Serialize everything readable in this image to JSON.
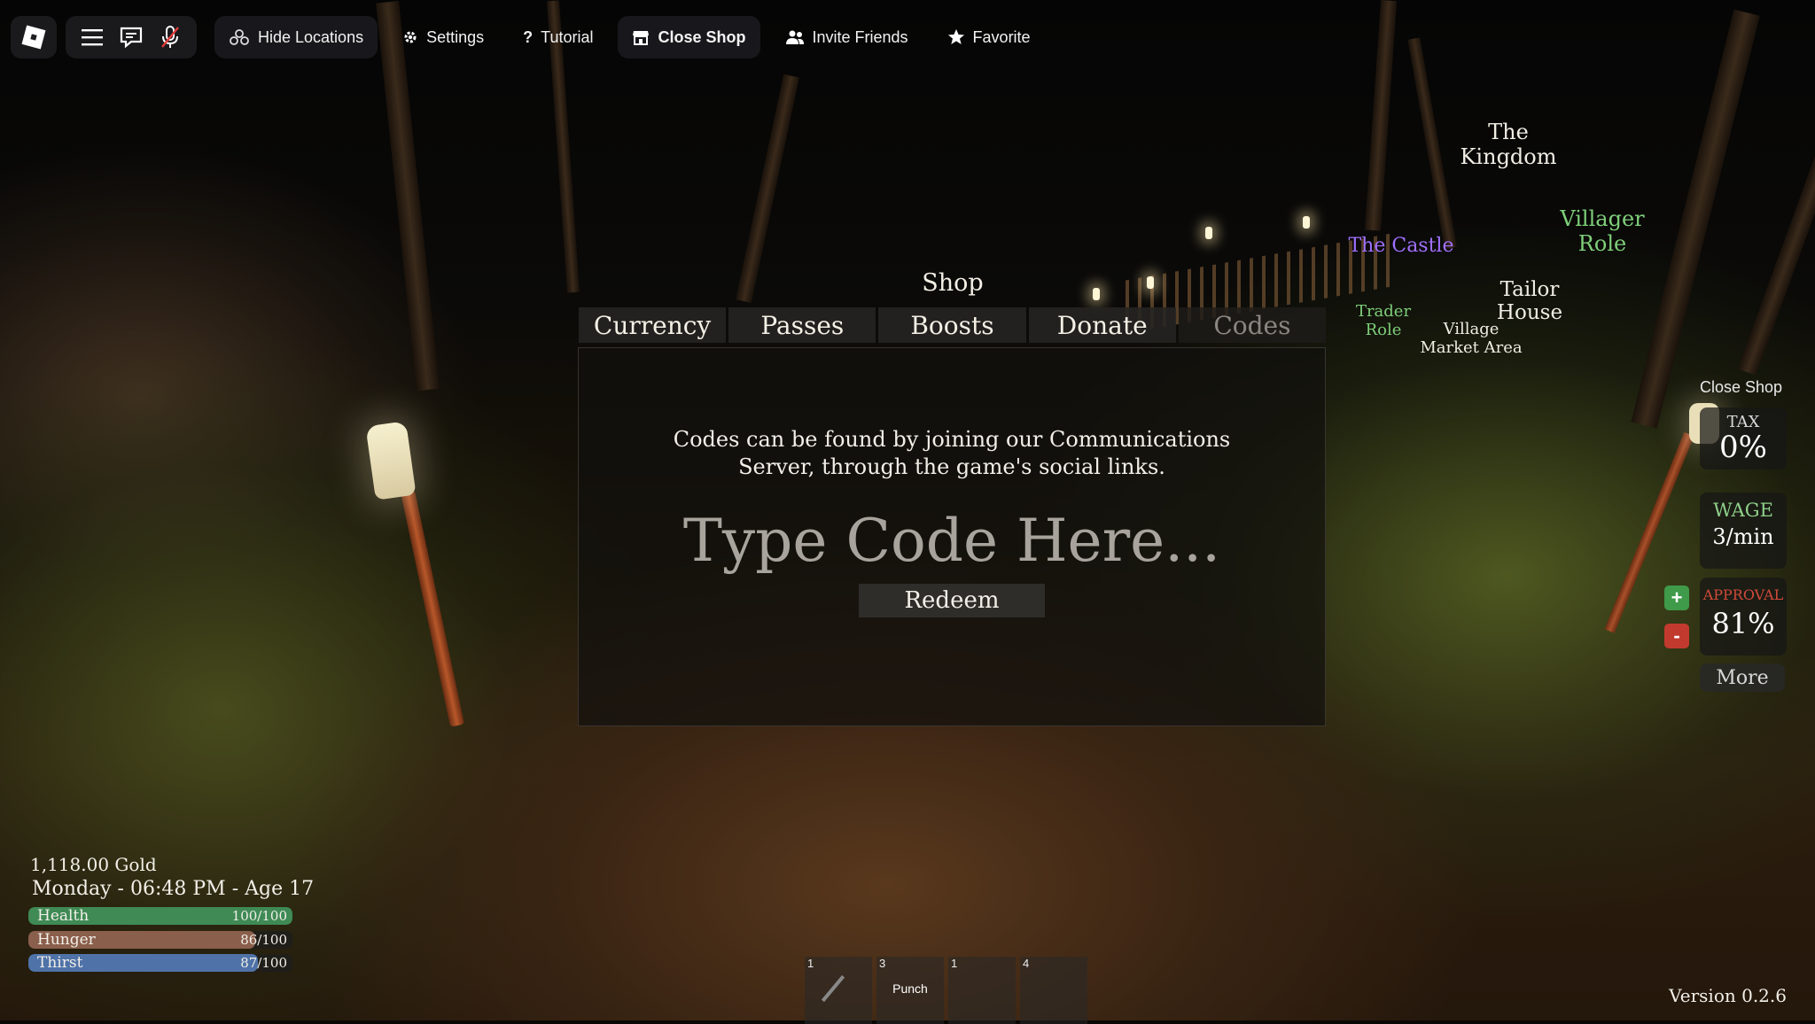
{
  "topbar": {
    "hide_locations": "Hide Locations",
    "settings": "Settings",
    "tutorial": "Tutorial",
    "close_shop": "Close Shop",
    "invite_friends": "Invite Friends",
    "favorite": "Favorite"
  },
  "shop": {
    "title": "Shop",
    "tabs": [
      "Currency",
      "Passes",
      "Boosts",
      "Donate",
      "Codes"
    ],
    "active_tab": "Codes",
    "info_line1": "Codes can be found by joining our Communications",
    "info_line2": "Server, through the game's social links.",
    "code_placeholder": "Type Code Here...",
    "redeem": "Redeem"
  },
  "map_labels": {
    "kingdom_1": "The",
    "kingdom_2": "Kingdom",
    "castle": "The Castle",
    "villager_1": "Villager",
    "villager_2": "Role",
    "tailor_1": "Tailor",
    "tailor_2": "House",
    "trader_1": "Trader",
    "trader_2": "Role",
    "market_1": "Village",
    "market_2": "Market Area"
  },
  "hud": {
    "close_shop": "Close Shop",
    "tax_label": "TAX",
    "tax_value": "0%",
    "wage_label": "WAGE",
    "wage_value": "3/min",
    "approval_label": "APPROVAL",
    "approval_value": "81%",
    "plus": "+",
    "minus": "-",
    "more": "More"
  },
  "player": {
    "gold": "1,118.00 Gold",
    "datetime": "Monday - 06:48 PM - Age 17",
    "stats": [
      {
        "name": "Health",
        "value": "100/100",
        "fraction": 1.0,
        "color": "#3f8a55"
      },
      {
        "name": "Hunger",
        "value": "86/100",
        "fraction": 0.86,
        "color": "#8a5f4c"
      },
      {
        "name": "Thirst",
        "value": "87/100",
        "fraction": 0.87,
        "color": "#4f73a8"
      }
    ]
  },
  "hotbar": {
    "slots": [
      {
        "num": "1",
        "label": ""
      },
      {
        "num": "3",
        "label": "Punch"
      },
      {
        "num": "1",
        "label": ""
      },
      {
        "num": "4",
        "label": ""
      }
    ]
  },
  "version": "Version 0.2.6",
  "colors": {
    "castle_label": "#a070ff",
    "role_label": "#7fcf7a",
    "wage_label": "#8fd08a",
    "approval_label": "#d04a3a",
    "plus_button": "#3f9a4a",
    "minus_button": "#c23a2e"
  },
  "icons": {
    "roblox": "roblox-logo-icon",
    "menu": "hamburger-menu-icon",
    "chat": "chat-icon",
    "mic": "microphone-icon",
    "hide_locations": "location-cluster-icon",
    "settings": "gear-icon",
    "tutorial": "question-mark-icon",
    "close_shop": "storefront-icon",
    "invite_friends": "people-icon",
    "favorite": "star-icon"
  }
}
